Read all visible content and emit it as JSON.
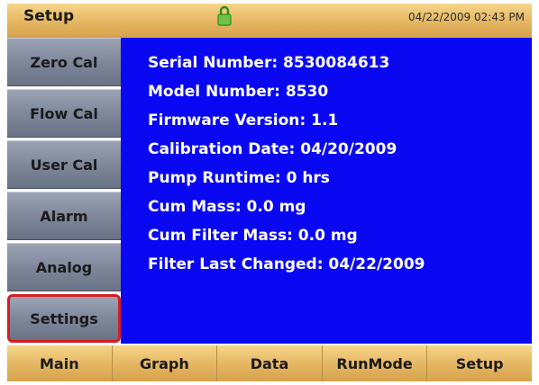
{
  "header": {
    "title": "Setup",
    "datetime": "04/22/2009 02:43 PM",
    "lock_icon": "lock-icon"
  },
  "sidebar": {
    "items": [
      {
        "label": "Zero Cal"
      },
      {
        "label": "Flow Cal"
      },
      {
        "label": "User Cal"
      },
      {
        "label": "Alarm"
      },
      {
        "label": "Analog"
      },
      {
        "label": "Settings",
        "selected": true
      }
    ]
  },
  "info": {
    "lines": [
      "Serial Number:  8530084613",
      "Model Number:  8530",
      "Firmware Version:  1.1",
      "Calibration Date:  04/20/2009",
      "Pump Runtime:  0 hrs",
      "Cum Mass:  0.0 mg",
      "Cum Filter Mass:  0.0 mg",
      "Filter Last Changed:  04/22/2009"
    ]
  },
  "nav": {
    "items": [
      {
        "label": "Main"
      },
      {
        "label": "Graph"
      },
      {
        "label": "Data"
      },
      {
        "label": "RunMode"
      },
      {
        "label": "Setup"
      }
    ]
  },
  "colors": {
    "panel_bg": "#0a08f2",
    "header_bg": "#e6b864",
    "button_bg": "#7f879a",
    "selection_outline": "#d21e26"
  }
}
